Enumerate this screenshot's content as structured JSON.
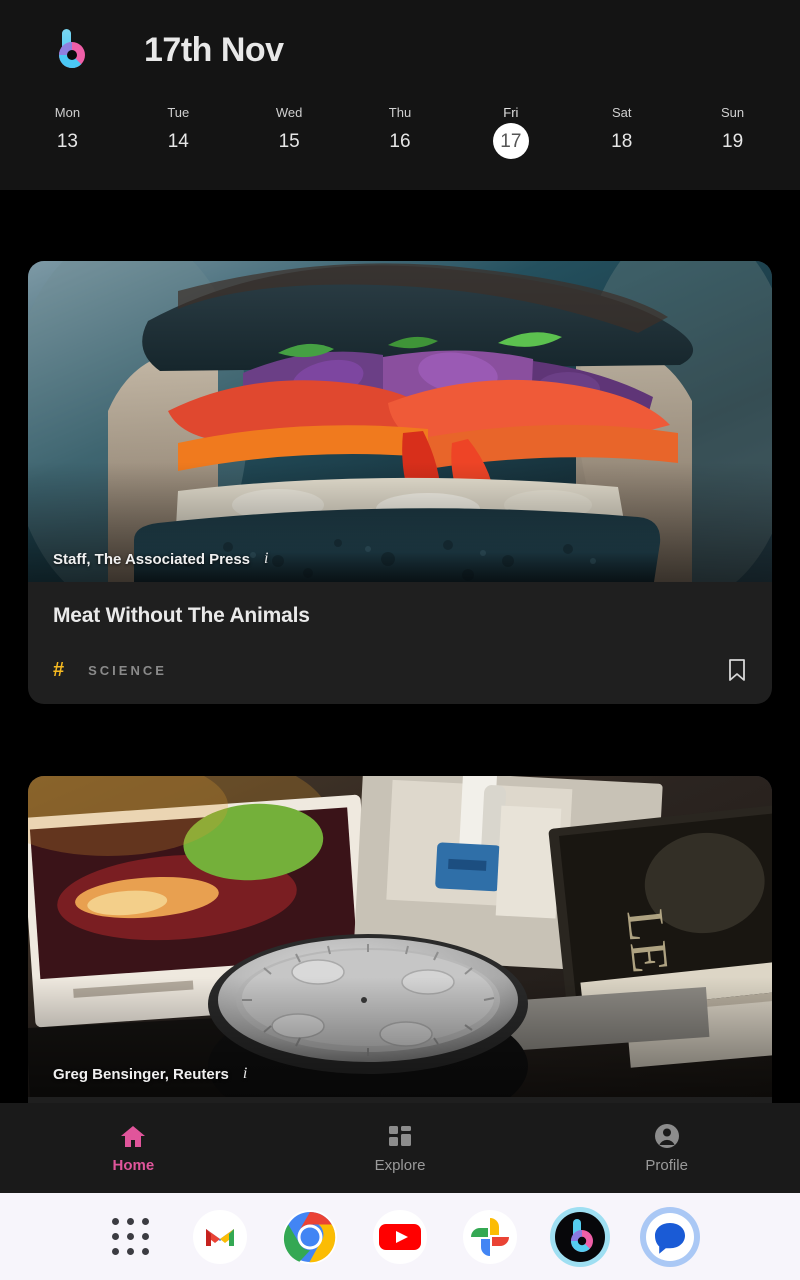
{
  "header": {
    "logo_icon": "b-logo-icon",
    "title": "17th Nov"
  },
  "calendar": {
    "days": [
      {
        "name": "Mon",
        "num": "13",
        "selected": false
      },
      {
        "name": "Tue",
        "num": "14",
        "selected": false
      },
      {
        "name": "Wed",
        "num": "15",
        "selected": false
      },
      {
        "name": "Thu",
        "num": "16",
        "selected": false
      },
      {
        "name": "Fri",
        "num": "17",
        "selected": true
      },
      {
        "name": "Sat",
        "num": "18",
        "selected": false
      },
      {
        "name": "Sun",
        "num": "19",
        "selected": false
      }
    ]
  },
  "feed": {
    "cards": [
      {
        "byline": "Staff, The Associated Press",
        "info_icon": "info-italic-icon",
        "title": "Meat Without The Animals",
        "hash_symbol": "#",
        "tag": "SCIENCE",
        "bookmark_icon": "bookmark-icon",
        "image_alt": "hands-holding-blue-bread-veggie-sandwich"
      },
      {
        "byline": "Greg Bensinger, Reuters",
        "info_icon": "info-italic-icon",
        "image_alt": "smart-speaker-on-desk-with-books"
      }
    ]
  },
  "bottom_nav": {
    "items": [
      {
        "label": "Home",
        "icon": "home-icon",
        "active": true
      },
      {
        "label": "Explore",
        "icon": "grid-icon",
        "active": false
      },
      {
        "label": "Profile",
        "icon": "account-circle-icon",
        "active": false
      }
    ]
  },
  "dock": {
    "apps": [
      {
        "name": "app-drawer-icon"
      },
      {
        "name": "gmail-icon"
      },
      {
        "name": "chrome-icon"
      },
      {
        "name": "youtube-icon"
      },
      {
        "name": "google-photos-icon"
      },
      {
        "name": "bundle-app-icon"
      },
      {
        "name": "google-messages-icon"
      }
    ]
  },
  "colors": {
    "accent_pink": "#e0559b",
    "tag_yellow": "#f5b921",
    "header_bg": "#141414",
    "card_bg": "#1f1f1f",
    "nav_bg": "#1a1a1a",
    "dock_bg": "#f7f5fb"
  }
}
